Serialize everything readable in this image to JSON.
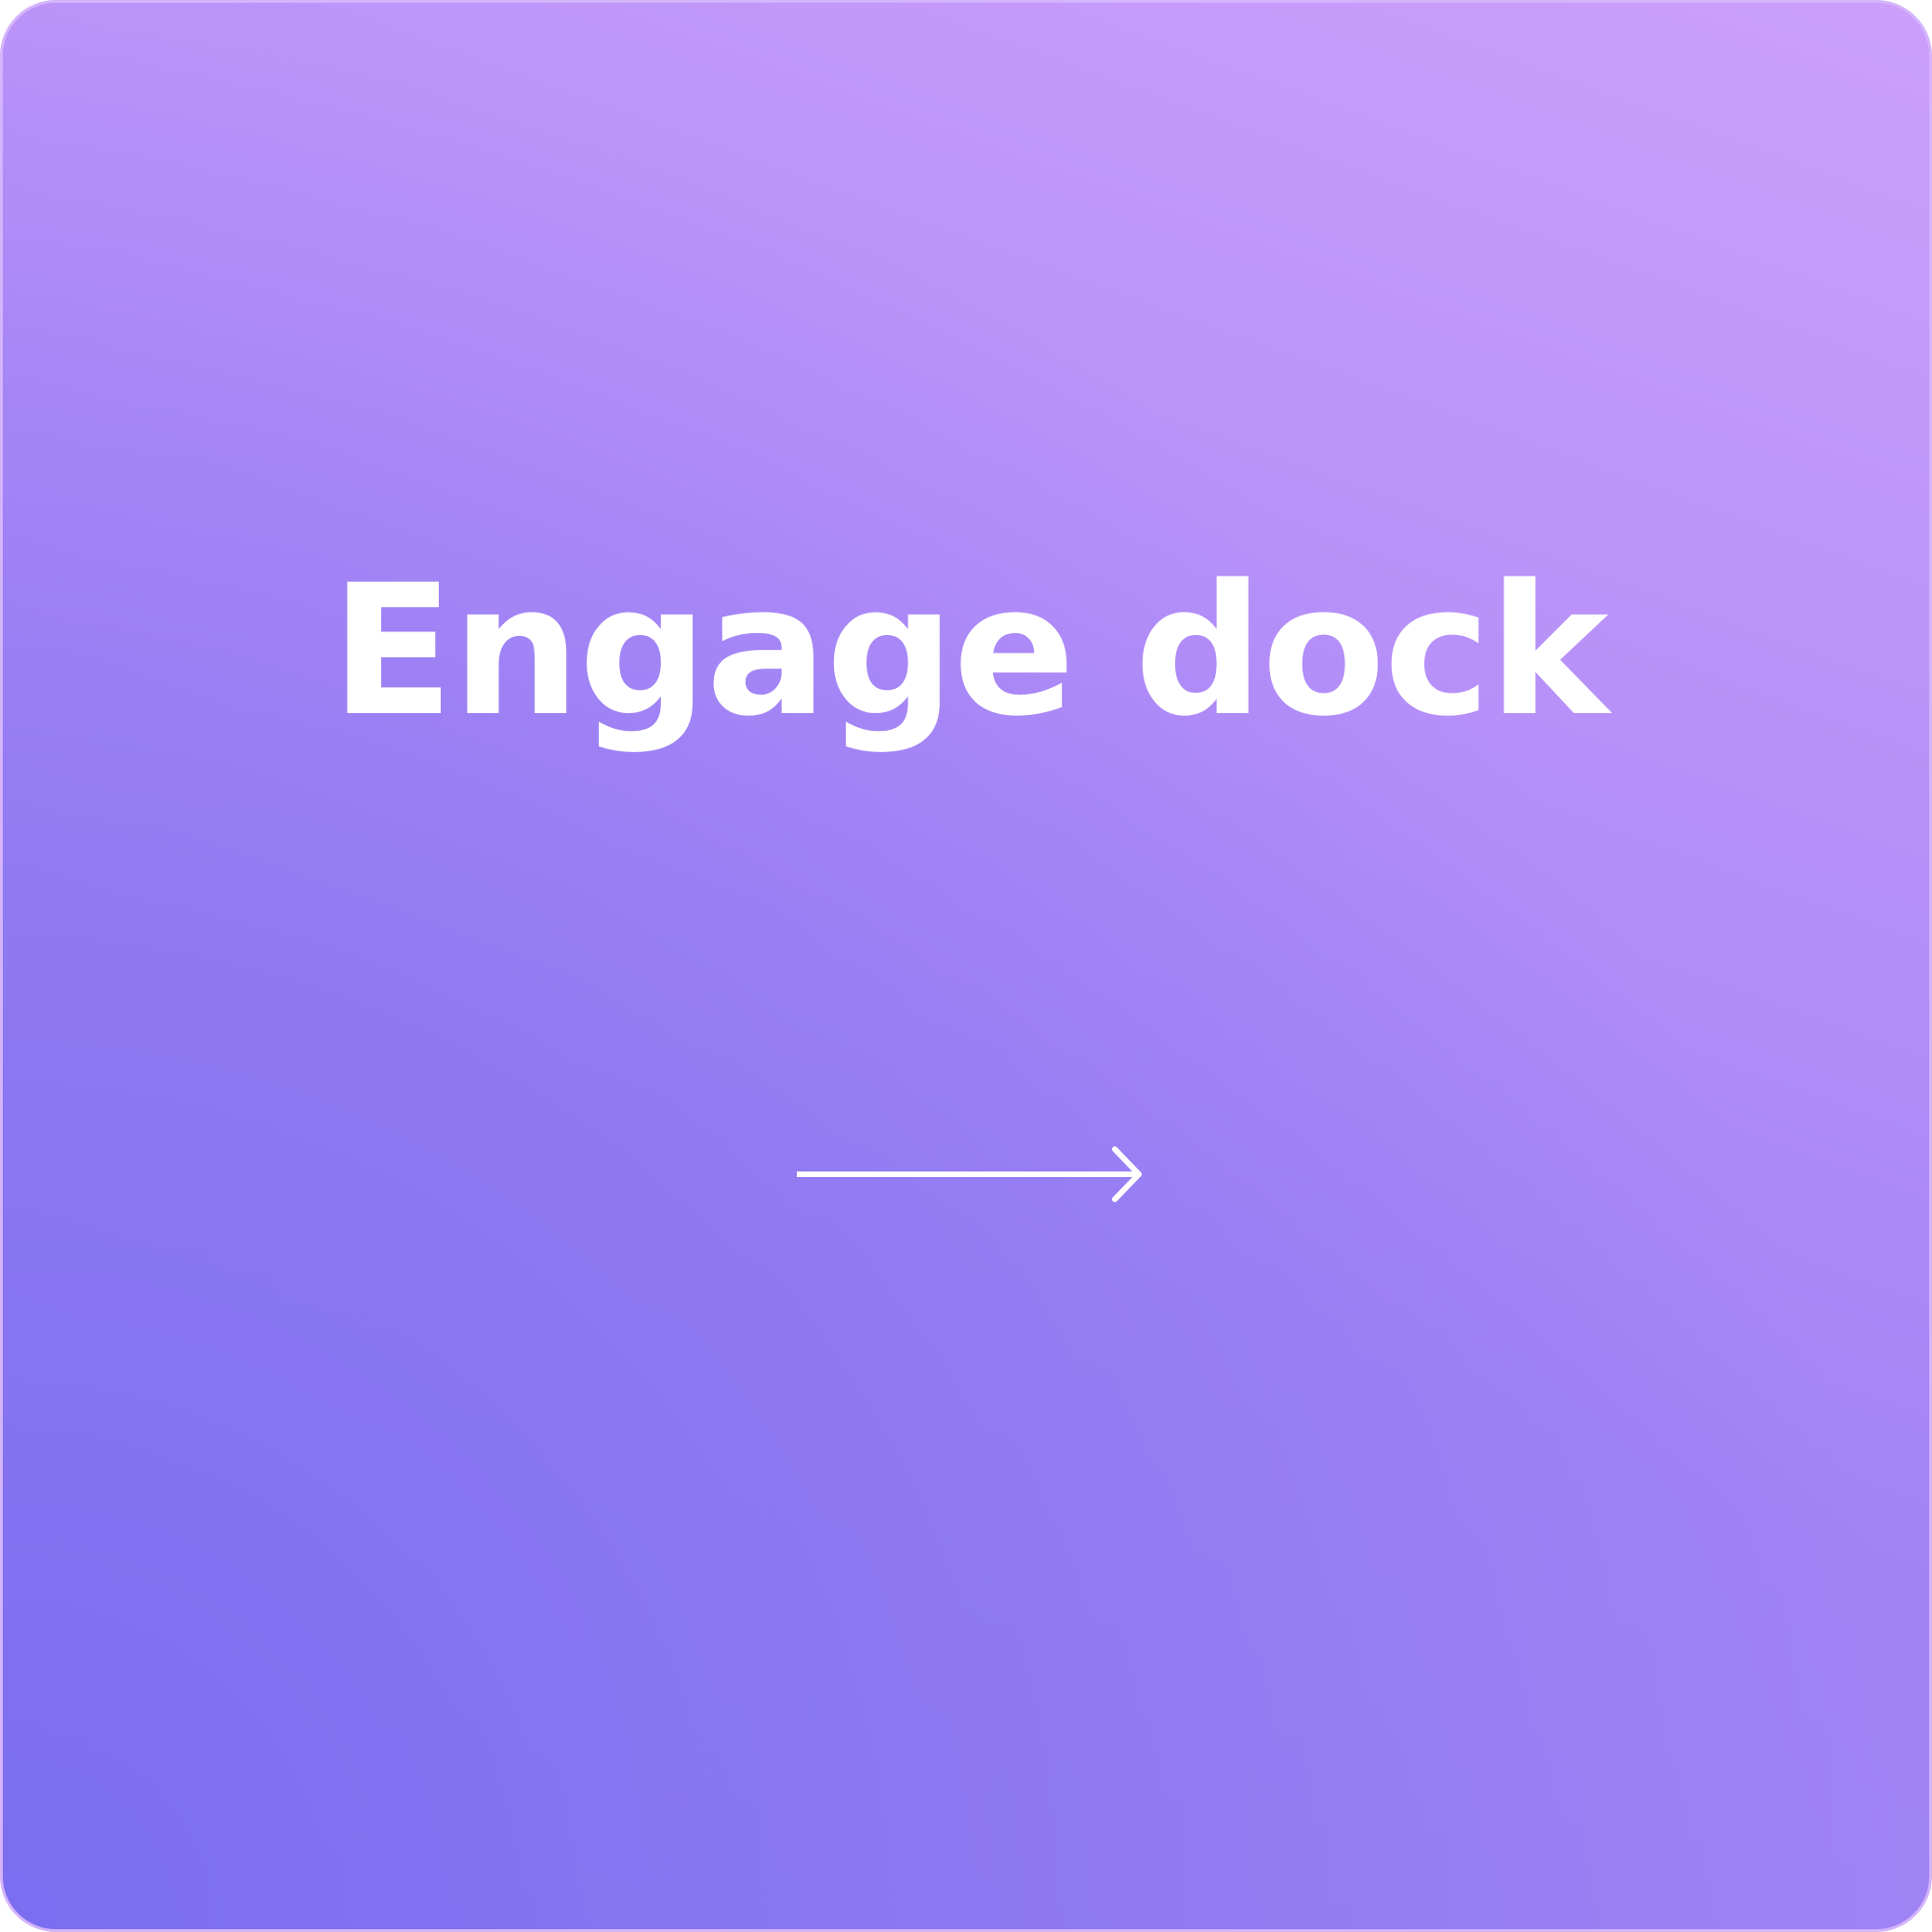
{
  "card": {
    "title": "Engage dock",
    "icon": "arrow-right-icon",
    "colors": {
      "gradient_start": "#7b6cf0",
      "gradient_end": "#cc9ffb",
      "text": "#ffffff",
      "border": "#d4b4fb"
    }
  }
}
